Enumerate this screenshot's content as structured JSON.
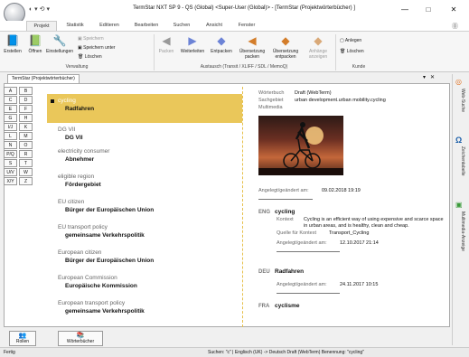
{
  "window": {
    "title": "TermStar NXT SP 9 - QS (Global) <Super-User (Global)> - [TermStar (Projektwörterbücher) ]",
    "min": "—",
    "max": "□",
    "close": "✕"
  },
  "menu": [
    "Projekt",
    "Statistik",
    "Editieren",
    "Bearbeiten",
    "Suchen",
    "Ansicht",
    "Fenster"
  ],
  "ribbon": {
    "erstellen": "Erstellen",
    "oeffnen": "Öffnen",
    "einstellungen": "Einstellungen",
    "speichern": "Speichern",
    "speichern_unter": "Speichern unter",
    "loeschen": "Löschen",
    "grp_verwaltung": "Verwaltung",
    "packen": "Packen",
    "weiterleiten": "Weiterleiten",
    "entpacken": "Entpacken",
    "uebersetzung_packen": "Übersetzung packen",
    "uebersetzung_entpacken": "Übersetzung entpacken",
    "anhaenge_anzeigen": "Anhänge anzeigen",
    "grp_austausch": "Austausch (Transit / XLIFF / SDL / MemoQ)",
    "anlegen": "Anlegen",
    "loeschen2": "Löschen",
    "grp_kunde": "Kunde"
  },
  "doctab": "TermStar (Projektwörterbücher)",
  "tabctrl": {
    "pin": "▾",
    "close": "✕"
  },
  "alpha": [
    "A",
    "B",
    "C",
    "D",
    "E",
    "F",
    "G",
    "H",
    "I/J",
    "K",
    "L",
    "M",
    "N",
    "O",
    "P/Q",
    "R",
    "S",
    "T",
    "U/V",
    "W",
    "X/Y",
    "Z"
  ],
  "entries": [
    {
      "src": "cycling",
      "tgt": "Radfahren"
    },
    {
      "src": "DG VII",
      "tgt": "DG VII"
    },
    {
      "src": "electricity consumer",
      "tgt": "Abnehmer"
    },
    {
      "src": "eligible region",
      "tgt": "Fördergebiet"
    },
    {
      "src": "EU citizen",
      "tgt": "Bürger der Europäischen Union"
    },
    {
      "src": "EU transport policy",
      "tgt": "gemeinsame Verkehrspolitik"
    },
    {
      "src": "European citizen",
      "tgt": "Bürger der Europäischen Union"
    },
    {
      "src": "European Commission",
      "tgt": "Europäische Kommission"
    },
    {
      "src": "European transport policy",
      "tgt": "gemeinsame Verkehrspolitik"
    }
  ],
  "detail": {
    "wb_label": "Wörterbuch",
    "wb_value": "Draft (WebTerm)",
    "sg_label": "Sachgebiet",
    "sg_value": "urban development.urban mobility.cycling",
    "mm_label": "Multimedia",
    "created_label": "Angelegt/geändert am:",
    "created_value": "09.02.2018 19:19",
    "eng_lang": "ENG",
    "eng_term": "cycling",
    "ctx_label": "Kontext",
    "ctx_value": "Cycling is an efficient way of using expensive and scarce space in urban areas, and is healthy, clean and cheap.",
    "qk_label": "Quelle für Kontext",
    "qk_value": "Transport_Cycling",
    "eng_date_label": "Angelegt/geändert am:",
    "eng_date": "12.10.2017 21:14",
    "deu_lang": "DEU",
    "deu_term": "Radfahren",
    "deu_date_label": "Angelegt/geändert am:",
    "deu_date": "24.11.2017 10:15",
    "fra_lang": "FRA",
    "fra_term": "cyclisme"
  },
  "sidebar": [
    "Web-Suche",
    "Zeichentabelle",
    "Multimedia-Anzeige"
  ],
  "bottom": {
    "rollen": "Rollen",
    "woerterbuecher": "Wörterbücher"
  },
  "status": {
    "left": "Fertig",
    "right": "Suchen: \"c\"  |  Englisch (UK) -> Deutsch  Draft (WebTerm)  Benennung: \"cycling\""
  }
}
